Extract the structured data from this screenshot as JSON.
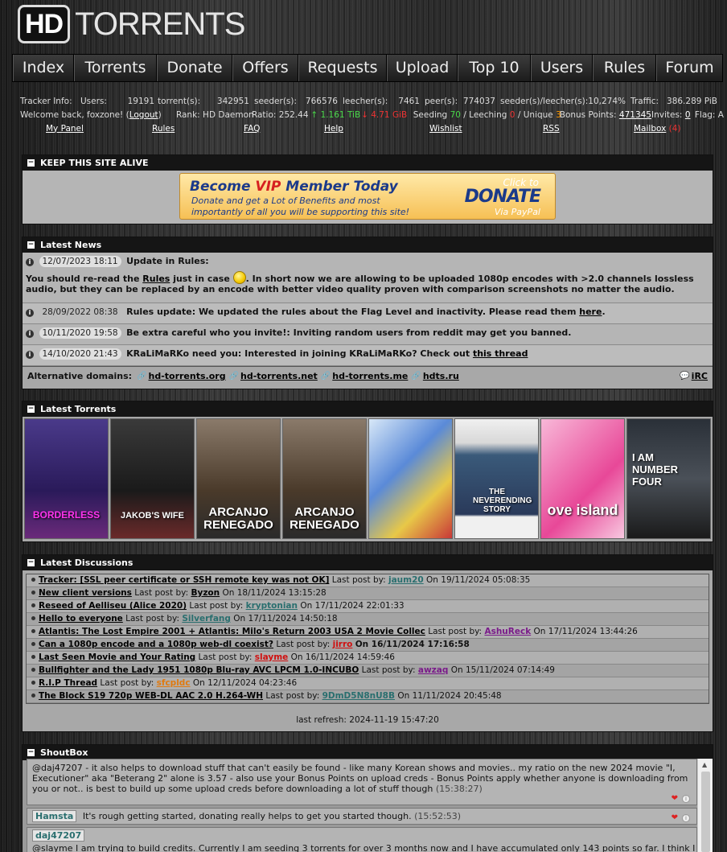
{
  "logo": {
    "hd": "HD",
    "text": "TORRENTS"
  },
  "nav": [
    "Index",
    "Torrents",
    "Donate",
    "Offers",
    "Requests",
    "Upload",
    "Top 10",
    "Users",
    "Rules",
    "Forum"
  ],
  "tracker": {
    "label": "Tracker Info:",
    "users_label": "Users:",
    "users": "19191",
    "torrents_label": "torrent(s):",
    "torrents": "342951",
    "seeders_label": "seeder(s):",
    "seeders": "766576",
    "leechers_label": "leecher(s):",
    "leechers": "7461",
    "peers_label": "peer(s):",
    "peers": "774037",
    "ratio_label": "seeder(s)/leecher(s):",
    "ratio": "10,274%",
    "traffic_label": "Traffic:",
    "traffic": "386.289 PiB"
  },
  "user": {
    "welcome": "Welcome back, foxzone! (",
    "logout": "Logout",
    "welcome_end": ")",
    "rank": "Rank: HD Daemon",
    "ratio": "Ratio: 252.44",
    "up": "↑ 1.161 TiB",
    "down": "↓ 4.71 GiB",
    "seeding_label": "Seeding",
    "seeding": "70",
    "leeching_label": "/ Leeching",
    "leeching": "0",
    "unique_label": "/ Unique",
    "unique": "3",
    "bonus_label": "Bonus Points:",
    "bonus": "471345",
    "invites_label": "Invites:",
    "invites": "0",
    "flag_label": "Flag: A"
  },
  "quicklinks": [
    "My Panel",
    "Rules",
    "FAQ",
    "Help",
    "Wishlist",
    "RSS",
    "Mailbox"
  ],
  "mailbox_count": "(4)",
  "keep_alive": {
    "header": "KEEP THIS SITE ALIVE",
    "title_pre": "Become ",
    "title_vip": "VIP",
    "title_post": " Member Today",
    "sub": "Donate and get a Lot of Benefits and most importantly of all you will be supporting this site!",
    "click": "Click to",
    "donate": "DONATE",
    "paypal": "Via PayPal"
  },
  "news": {
    "header": "Latest News",
    "items": [
      {
        "date": "12/07/2023 18:11",
        "title": "Update in Rules:",
        "body_pre": "You should re-read the ",
        "link": "Rules",
        "body_mid": " just in case ",
        "body_post": ". In short now we are allowing to be uploaded 1080p encodes with >2.0 channels lossless audio, but they can be replaced by an encode with better video quality proven with comparison screenshots no matter the audio."
      },
      {
        "date": "28/09/2022 08:38",
        "title": "Rules update:",
        "body": " We updated the rules about the Flag Level and inactivity. Please read them ",
        "link": "here",
        "end": "."
      },
      {
        "date": "10/11/2020 19:58",
        "title": "Be extra careful who you invite!:",
        "body": " Inviting random users from reddit may get you banned."
      },
      {
        "date": "14/10/2020 21:43",
        "title": "KRaLiMaRKo need you:",
        "body": " Interested in joining KRaLiMaRKo? Check out ",
        "link": "this thread"
      }
    ],
    "alt_label": "Alternative domains:",
    "domains": [
      "hd-torrents.org",
      "hd-torrents.net",
      "hd-torrents.me",
      "hdts.ru"
    ],
    "irc": "iRC"
  },
  "latest_torrents": {
    "header": "Latest Torrents",
    "posters": [
      {
        "text": "BORDERLESS",
        "bg": "#3a2a6a"
      },
      {
        "text": "JAKOB'S WIFE",
        "bg": "#2a2a2a"
      },
      {
        "text": "ARCANJO RENEGADO",
        "bg": "#5a4a3a"
      },
      {
        "text": "ARCANJO RENEGADO",
        "bg": "#5a4a3a"
      },
      {
        "text": "",
        "bg": "#4a78c8"
      },
      {
        "text": "THE NEVERENDING STORY",
        "bg": "#e8e8e8"
      },
      {
        "text": "ove island",
        "bg": "#e85aa8"
      },
      {
        "text": "I AM NUMBER FOUR",
        "bg": "#2a3038"
      }
    ]
  },
  "discussions": {
    "header": "Latest Discussions",
    "rows": [
      {
        "title": "Tracker: [SSL peer certificate or SSH remote key was not OK]",
        "user": "jaum20",
        "user_color": "#2a6f6f",
        "date": "On 19/11/2024 05:08:35"
      },
      {
        "title": "New client versions",
        "user": "Byzon",
        "user_color": "#000000",
        "date": "On 18/11/2024 13:15:28"
      },
      {
        "title": "Reseed of Aelliseu (Alice 2020)",
        "user": "kryptonian",
        "user_color": "#2a6f6f",
        "date": "On 17/11/2024 22:01:33"
      },
      {
        "title": "Hello to everyone",
        "user": "Silverfang",
        "user_color": "#2a6f6f",
        "date": "On 17/11/2024 14:50:18"
      },
      {
        "title": "Atlantis: The Lost Empire 2001 + Atlantis: Milo's Return 2003 USA 2 Movie Collec",
        "user": "AshuReck",
        "user_color": "#7a1a8a",
        "date": "On 17/11/2024 13:44:26"
      },
      {
        "title": "Can a 1080p encode and a 1080p web-dl coexist?",
        "user": "jirro",
        "user_color": "#d01010",
        "date": "On 16/11/2024 17:16:58"
      },
      {
        "title": "Last Seen Movie and Your Rating",
        "user": "slayme",
        "user_color": "#d01010",
        "date": "On 16/11/2024 14:59:46"
      },
      {
        "title": "Bullfighter and the Lady 1951 1080p Blu-ray AVC LPCM 1.0-INCUBO",
        "user": "awzaq",
        "user_color": "#7a1a8a",
        "date": "On 15/11/2024 07:14:49"
      },
      {
        "title": "R.I.P Thread",
        "user": "sfcpldc",
        "user_color": "#e07a10",
        "date": "On 12/11/2024 04:23:46"
      },
      {
        "title": "The Block S19 720p WEB-DL AAC 2.0 H.264-WH",
        "user": "9DmD5N8nU8B",
        "user_color": "#2a6f6f",
        "date": "On 11/11/2024 20:45:48"
      }
    ],
    "last_post_by": "Last post by:",
    "refresh": "last refresh: 2024-11-19 15:47:20"
  },
  "shoutbox": {
    "header": "ShoutBox",
    "messages": [
      {
        "user": "",
        "text": "@daj47207 - it also helps to download stuff that can't easily be found - like many Korean shows and movies..  my ratio on the new 2024 movie \"I, Executioner\" aka \"Beterang 2\" alone is 3.57 - also use your Bonus Points on upload creds - Bonus Points apply whether anyone is downloading from you or not..  is best to build up some upload creds before downloading a lot of stuff though",
        "time": "(15:38:27)"
      },
      {
        "user": "Hamsta",
        "text": "It's rough getting started, donating really helps to get you started though.",
        "time": "(15:52:53)"
      },
      {
        "user": "daj47207",
        "text": "@slayme I am trying to build credits. Currently I am seeding 3 torrents for over 3 months now and I have accumulated only 143 points so far. I think I",
        "time": ""
      }
    ]
  }
}
